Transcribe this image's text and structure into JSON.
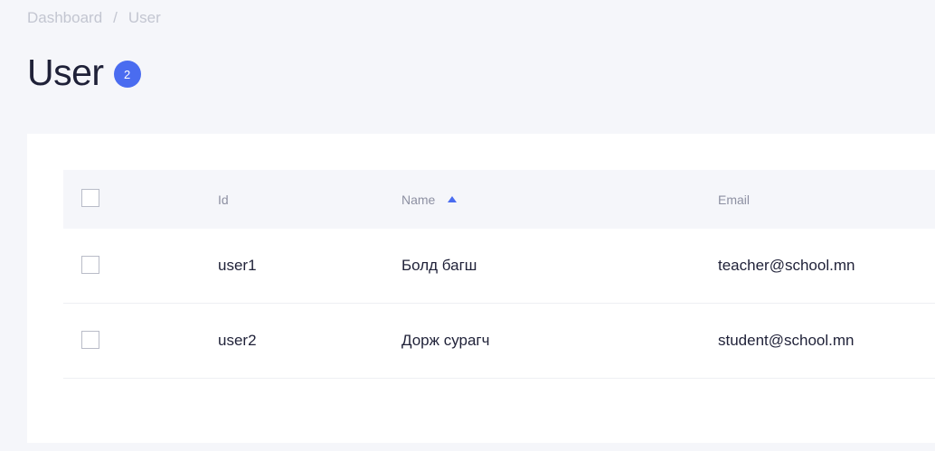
{
  "breadcrumb": {
    "items": [
      "Dashboard",
      "User"
    ],
    "separator": "/"
  },
  "header": {
    "title": "User",
    "count": "2"
  },
  "table": {
    "columns": {
      "id": "Id",
      "name": "Name",
      "email": "Email"
    },
    "sort": {
      "column": "name",
      "direction": "ascending",
      "icon": "sort-ascending-icon"
    },
    "rows": [
      {
        "id": "user1",
        "name": "Болд багш",
        "email": "teacher@school.mn"
      },
      {
        "id": "user2",
        "name": "Дорж сурагч",
        "email": "student@school.mn"
      }
    ]
  },
  "colors": {
    "accent": "#4a6cf0",
    "background": "#f5f6fa",
    "card": "#ffffff",
    "text": "#1f2138",
    "muted": "#8d90a2"
  }
}
